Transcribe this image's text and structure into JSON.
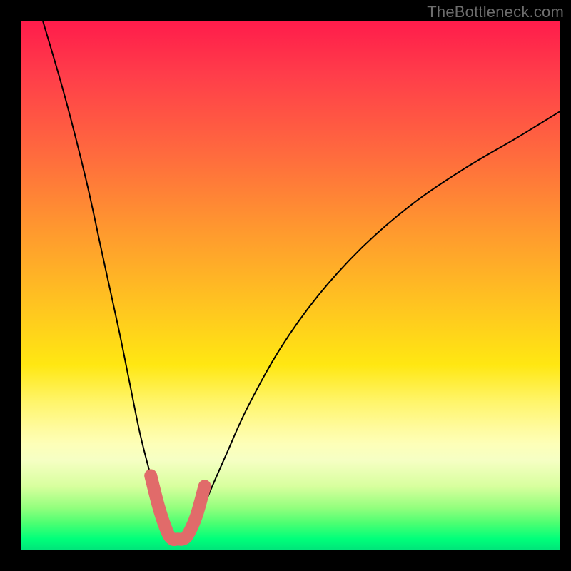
{
  "attribution": "TheBottleneck.com",
  "chart_data": {
    "type": "line",
    "title": "",
    "xlabel": "",
    "ylabel": "",
    "xlim": [
      0,
      100
    ],
    "ylim": [
      0,
      100
    ],
    "grid": false,
    "legend": false,
    "series": [
      {
        "name": "bottleneck-curve",
        "color": "#000000",
        "x": [
          4,
          8,
          12,
          15,
          18,
          20,
          22,
          24,
          26,
          27,
          28,
          29,
          30,
          31,
          33,
          35,
          38,
          42,
          48,
          55,
          63,
          72,
          82,
          92,
          100
        ],
        "y": [
          100,
          86,
          70,
          56,
          42,
          32,
          22,
          14,
          7,
          3.5,
          2,
          2,
          2,
          3,
          6,
          11,
          18,
          27,
          38,
          48,
          57,
          65,
          72,
          78,
          83
        ]
      },
      {
        "name": "valley-highlight",
        "color": "#e16b6a",
        "x": [
          24,
          25.5,
          27,
          28,
          29,
          30,
          31,
          32.5,
          34
        ],
        "y": [
          14,
          8,
          3.5,
          2,
          2,
          2,
          3,
          6.5,
          12
        ]
      }
    ],
    "gradient_stops": [
      {
        "pos": 0,
        "color": "#ff1c4b"
      },
      {
        "pos": 25,
        "color": "#ff6a3e"
      },
      {
        "pos": 55,
        "color": "#ffc81f"
      },
      {
        "pos": 77,
        "color": "#fffb9e"
      },
      {
        "pos": 92,
        "color": "#95ff7e"
      },
      {
        "pos": 100,
        "color": "#00e57a"
      }
    ]
  }
}
